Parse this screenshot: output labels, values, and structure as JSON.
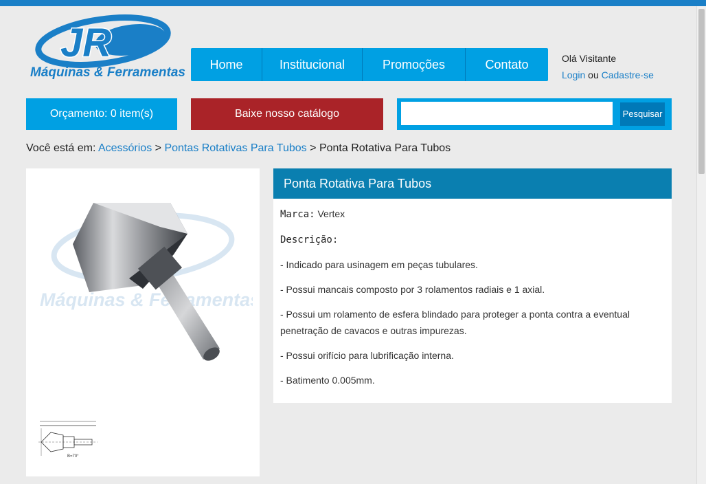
{
  "header": {
    "logo_mark": "JR",
    "logo_text": "Máquinas & Ferramentas"
  },
  "nav": {
    "home": "Home",
    "institucional": "Institucional",
    "promocoes": "Promoções",
    "contato": "Contato"
  },
  "user": {
    "greeting": "Olá Visitante",
    "login": "Login",
    "or": "ou",
    "signup": "Cadastre-se"
  },
  "actions": {
    "orcamento": "Orçamento: 0 item(s)",
    "catalogo": "Baixe nosso catálogo",
    "search_button": "Pesquisar",
    "search_value": ""
  },
  "breadcrumb": {
    "prefix": "Você está em:",
    "level1": "Acessórios",
    "sep": ">",
    "level2": "Pontas Rotativas Para Tubos",
    "current": "Ponta Rotativa Para Tubos"
  },
  "product": {
    "title": "Ponta Rotativa Para Tubos",
    "brand_label": "Marca:",
    "brand": "Vertex",
    "desc_label": "Descrição:",
    "bullets": [
      "- Indicado para usinagem em peças tubulares.",
      "- Possui mancais composto por 3 rolamentos radiais e 1 axial.",
      "- Possui um rolamento de esfera blindado para proteger a ponta contra a eventual penetração de cavacos e outras impurezas.",
      "- Possui orifício para lubrificação interna.",
      "- Batimento 0.005mm."
    ],
    "watermark_text": "Máquinas & Ferramentas"
  },
  "colors": {
    "brand_blue": "#1a7fc7",
    "nav_blue": "#00a0e3",
    "catalog_red": "#aa2328",
    "header_blue": "#0a7fb0"
  }
}
